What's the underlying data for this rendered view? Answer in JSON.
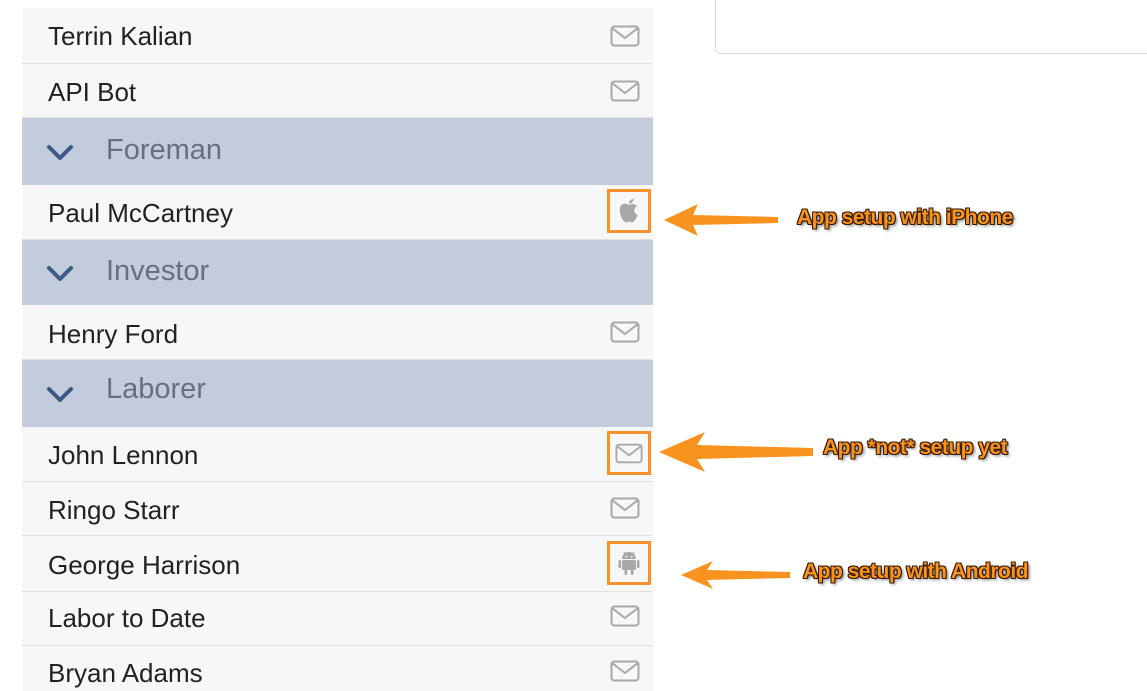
{
  "list": {
    "items": [
      {
        "kind": "person",
        "name": "Terrin Kalian",
        "icon": "mail-icon"
      },
      {
        "kind": "person",
        "name": "API Bot",
        "icon": "mail-icon"
      },
      {
        "kind": "group",
        "name": "Foreman"
      },
      {
        "kind": "person",
        "name": "Paul McCartney",
        "icon": "apple-icon",
        "highlighted": true
      },
      {
        "kind": "group",
        "name": "Investor"
      },
      {
        "kind": "person",
        "name": "Henry Ford",
        "icon": "mail-icon"
      },
      {
        "kind": "group",
        "name": "Laborer"
      },
      {
        "kind": "person",
        "name": "John Lennon",
        "icon": "mail-icon",
        "highlighted": true
      },
      {
        "kind": "person",
        "name": "Ringo Starr",
        "icon": "mail-icon"
      },
      {
        "kind": "person",
        "name": "George Harrison",
        "icon": "android-icon",
        "highlighted": true
      },
      {
        "kind": "person",
        "name": "Labor to Date",
        "icon": "mail-icon"
      },
      {
        "kind": "person",
        "name": "Bryan Adams",
        "icon": "mail-icon"
      }
    ]
  },
  "annotations": [
    {
      "text": "App setup with iPhone",
      "color": "#f7931e"
    },
    {
      "text": "App *not* setup yet",
      "color": "#f7931e"
    },
    {
      "text": "App setup with Android",
      "color": "#f7931e"
    }
  ],
  "colors": {
    "group_header": "#c3ccdc",
    "row_background": "#f7f7f7",
    "highlight": "#f5922b",
    "icon": "#a8a8a8",
    "chevron": "#3d5a86"
  }
}
